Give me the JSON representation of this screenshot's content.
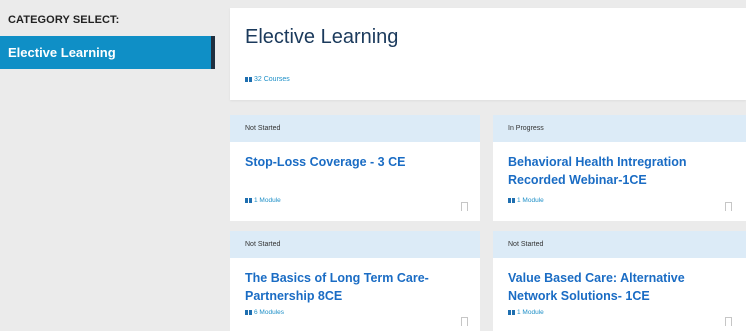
{
  "sidebar": {
    "heading": "CATEGORY SELECT:",
    "items": [
      {
        "label": "Elective Learning",
        "active": true
      }
    ]
  },
  "header": {
    "title": "Elective Learning",
    "course_count": "32 Courses"
  },
  "cards": [
    {
      "status": "Not Started",
      "title": "Stop-Loss Coverage - 3 CE",
      "modules": "1 Module"
    },
    {
      "status": "In Progress",
      "title": "Behavioral Health Intregration Recorded Webinar-1CE",
      "modules": "1 Module"
    },
    {
      "status": "Not Started",
      "title": "The Basics of Long Term Care-Partnership 8CE",
      "modules": "6 Modules"
    },
    {
      "status": "Not Started",
      "title": "Value Based Care: Alternative Network Solutions- 1CE",
      "modules": "1 Module"
    }
  ],
  "colors": {
    "accent": "#0f8fc6",
    "title_link": "#1a6cc4",
    "status_bg": "#dcebf7"
  }
}
